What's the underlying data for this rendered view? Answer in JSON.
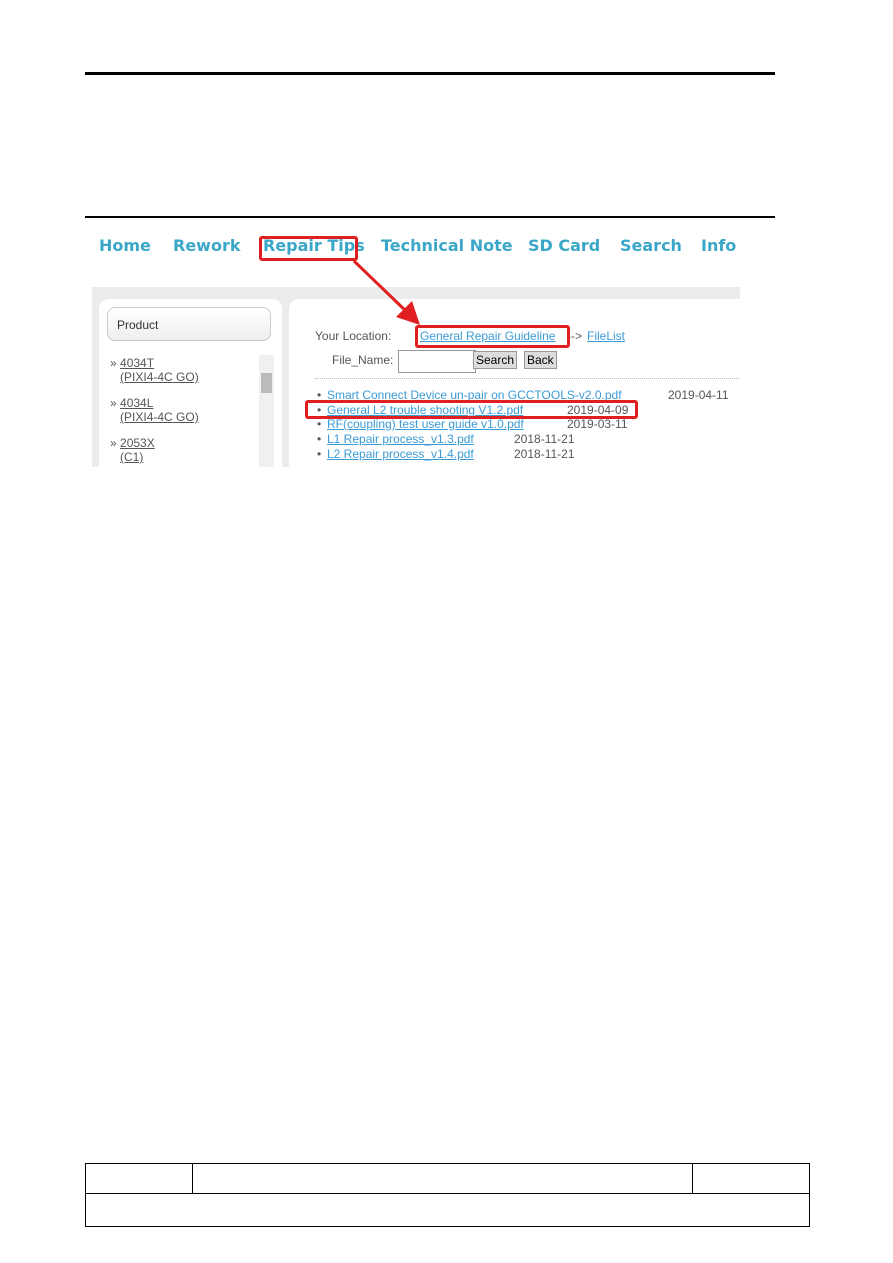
{
  "nav": {
    "items": [
      "Home",
      "Rework",
      "Repair Tips",
      "Technical Note",
      "SD Card",
      "Search",
      "Info"
    ]
  },
  "sidebar": {
    "title": "Product",
    "items": [
      {
        "model": "4034T",
        "name": "(PIXI4-4C GO)"
      },
      {
        "model": "4034L",
        "name": "(PIXI4-4C GO)"
      },
      {
        "model": "2053X",
        "name": "(C1)"
      }
    ]
  },
  "location": {
    "label": "Your Location:",
    "crumb": "General Repair Guideline",
    "sep": "-->",
    "current": "FileList"
  },
  "search": {
    "label": "File_Name:",
    "value": "",
    "search_button": "Search",
    "back_button": "Back"
  },
  "files": [
    {
      "name": "Smart Connect Device un-pair on GCCTOOLS-v2.0.pdf",
      "date": "2019-04-11"
    },
    {
      "name": "General L2 trouble shooting V1.2.pdf",
      "date": "2019-04-09"
    },
    {
      "name": "RF(coupling) test user guide v1.0.pdf",
      "date": "2019-03-11"
    },
    {
      "name": "L1 Repair process_v1.3.pdf",
      "date": "2018-11-21"
    },
    {
      "name": "L2 Repair process_v1.4.pdf",
      "date": "2018-11-21"
    }
  ],
  "colors": {
    "nav": "#3aa7c9",
    "highlight": "#e02020",
    "link": "#3a9bd6"
  }
}
